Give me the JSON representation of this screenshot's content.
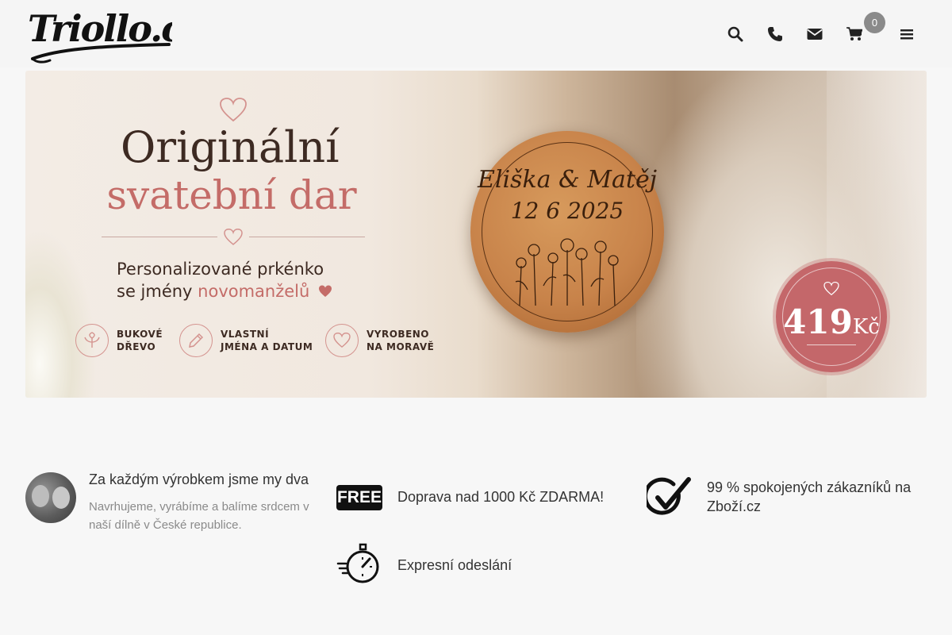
{
  "header": {
    "logo": "Triollo.cz",
    "cart_count": "0",
    "icons": [
      "search-icon",
      "phone-icon",
      "envelope-icon",
      "cart-icon",
      "menu-icon"
    ]
  },
  "hero": {
    "title_line1": "Originální",
    "title_line2": "svatební dar",
    "subtitle_line1": "Personalizované prkénko",
    "subtitle_line2_prefix": "se jmény ",
    "subtitle_line2_highlight": "novomanželů",
    "features": [
      {
        "line1": "BUKOVÉ",
        "line2": "DŘEVO",
        "icon": "leaf-icon"
      },
      {
        "line1": "VLASTNÍ",
        "line2": "JMÉNA A DATUM",
        "icon": "pencil-icon"
      },
      {
        "line1": "VYROBENO",
        "line2": "NA MORAVĚ",
        "icon": "heart-icon"
      }
    ],
    "board_names": "Eliška & Matěj",
    "board_date": "12 6 2025",
    "price_value": "419",
    "price_currency": "Kč",
    "colors": {
      "accent": "#c46c68",
      "text": "#3d2a22"
    }
  },
  "features": {
    "team_title": "Za každým výrobkem jsme my dva",
    "team_desc_line1": "Navrhujeme, vyrábíme a balíme srdcem v",
    "team_desc_line2": "naší dílně v České republice.",
    "free_badge": "FREE",
    "shipping_text": "Doprava nad 1000 Kč ZDARMA!",
    "rating_line1": "99 % spokojených zákazníků na",
    "rating_line2": "Zboží.cz",
    "express_text": "Expresní odeslání"
  }
}
